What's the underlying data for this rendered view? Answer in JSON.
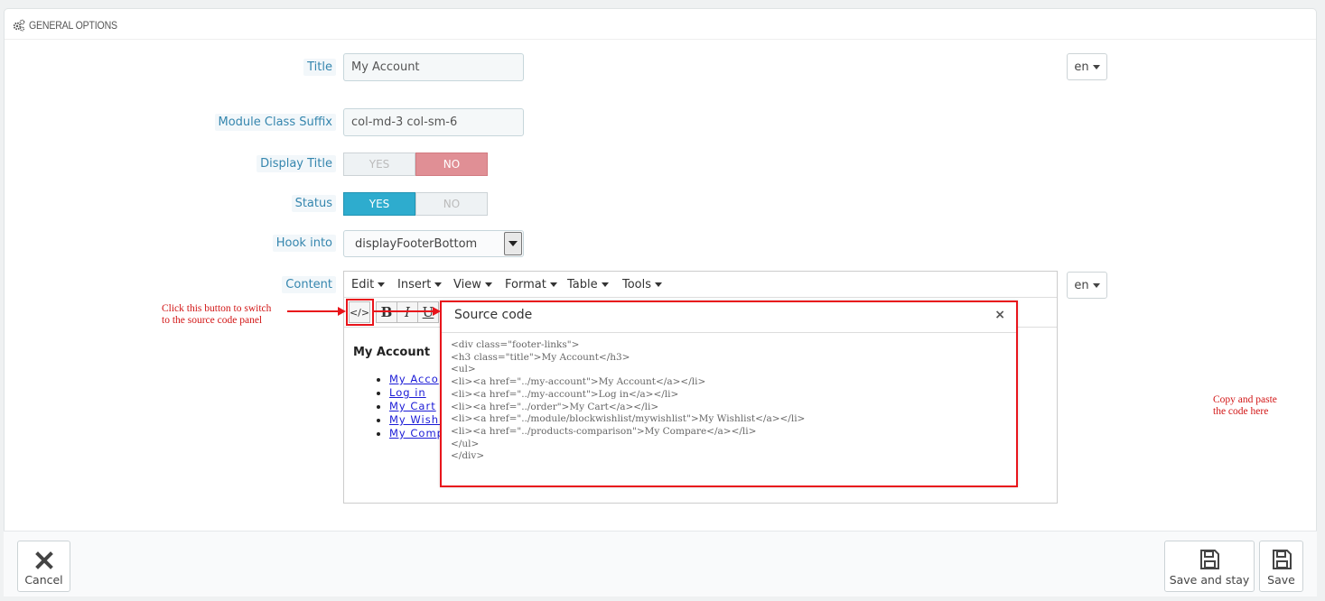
{
  "panel": {
    "heading": "GENERAL OPTIONS",
    "heading_icon": "cogs-icon"
  },
  "fields": {
    "title": {
      "label": "Title",
      "value": "My Account",
      "lang": "en"
    },
    "suffix": {
      "label": "Module Class Suffix",
      "value": "col-md-3 col-sm-6"
    },
    "display_title": {
      "label": "Display Title",
      "yes": "YES",
      "no": "NO",
      "selected": "NO"
    },
    "status": {
      "label": "Status",
      "yes": "YES",
      "no": "NO",
      "selected": "YES"
    },
    "hook": {
      "label": "Hook into",
      "value": "displayFooterBottom"
    },
    "content": {
      "label": "Content",
      "lang": "en"
    }
  },
  "editor": {
    "menu": [
      "Edit",
      "Insert",
      "View",
      "Format",
      "Table",
      "Tools"
    ],
    "toolbar": {
      "source": "</>",
      "bold": "B",
      "italic": "I",
      "underline": "U"
    },
    "preview": {
      "heading": "My Account",
      "links": [
        "My Acco",
        "Log in",
        "My Cart",
        "My Wishl",
        "My Comp"
      ]
    }
  },
  "source_dialog": {
    "title": "Source code",
    "close": "×",
    "code": "<div class=\"footer-links\">\n<h3 class=\"title\">My Account</h3>\n<ul>\n<li><a href=\"../my-account\">My Account</a></li>\n<li><a href=\"../my-account\">Log in</a></li>\n<li><a href=\"../order\">My Cart</a></li>\n<li><a href=\"../module/blockwishlist/mywishlist\">My Wishlist</a></li>\n<li><a href=\"../products-comparison\">My Compare</a></li>\n</ul>\n</div>"
  },
  "annotations": {
    "left_line1": "Click this button to switch",
    "left_line2": "to the source code panel",
    "right_line1": "Copy and paste",
    "right_line2": "the code here"
  },
  "footer": {
    "cancel": "Cancel",
    "save_stay": "Save and stay",
    "save": "Save"
  }
}
